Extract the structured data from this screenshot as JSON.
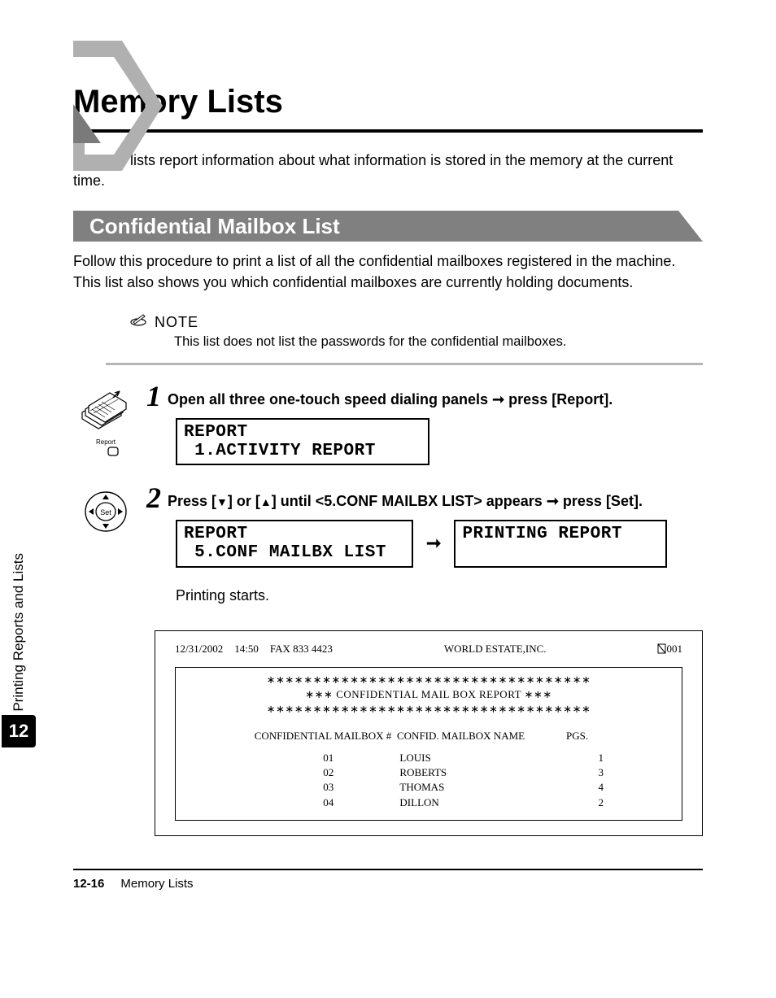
{
  "title": "Memory Lists",
  "intro": "Memory lists report information about what information is stored in the memory at the current time.",
  "section": {
    "heading": "Confidential Mailbox List"
  },
  "follow_para": "Follow this procedure to print a list of all the confidential mailboxes registered in the machine. This list also shows you which confidential mailboxes are currently holding documents.",
  "note": {
    "label": "NOTE",
    "text": "This list does not list the passwords for the confidential mailboxes."
  },
  "buttons": {
    "report_label": "Report",
    "set_label": "Set"
  },
  "step1": {
    "num": "1",
    "text_a": "Open all three one-touch speed dialing panels ",
    "text_b": " press [Report].",
    "arrow": "➞",
    "lcd": "REPORT\n 1.ACTIVITY REPORT"
  },
  "step2": {
    "num": "2",
    "text_a": "Press [",
    "tri_down": "▼",
    "text_b": "] or [",
    "tri_up": "▲",
    "text_c": "] until <5.CONF MAILBX LIST> appears ",
    "arrow": "➞",
    "text_d": " press [Set].",
    "lcd_left": "REPORT\n 5.CONF MAILBX LIST",
    "lcd_right": "PRINTING REPORT\n ",
    "between_arrow": "➞"
  },
  "printing_starts": "Printing starts.",
  "report": {
    "header": {
      "date": "12/31/2002",
      "time": "14:50",
      "fax": "FAX 833 4423",
      "company": "WORLD ESTATE,INC.",
      "pagecounter": "001"
    },
    "divider": "∗∗∗∗∗∗∗∗∗∗∗∗∗∗∗∗∗∗∗∗∗∗∗∗∗∗∗∗∗∗∗∗∗∗∗",
    "title": "∗∗∗ CONFIDENTIAL MAIL BOX REPORT ∗∗∗",
    "columns": {
      "c1": "CONFIDENTIAL MAILBOX #",
      "c2": "CONFID. MAILBOX NAME",
      "c3": "PGS."
    },
    "rows": [
      {
        "c1": "01",
        "c2": "LOUIS",
        "c3": "1"
      },
      {
        "c1": "02",
        "c2": "ROBERTS",
        "c3": "3"
      },
      {
        "c1": "03",
        "c2": "THOMAS",
        "c3": "4"
      },
      {
        "c1": "04",
        "c2": "DILLON",
        "c3": "2"
      }
    ]
  },
  "sidetab": {
    "label": "Printing Reports and Lists",
    "num": "12"
  },
  "footer": {
    "page": "12-16",
    "title": "Memory Lists"
  }
}
